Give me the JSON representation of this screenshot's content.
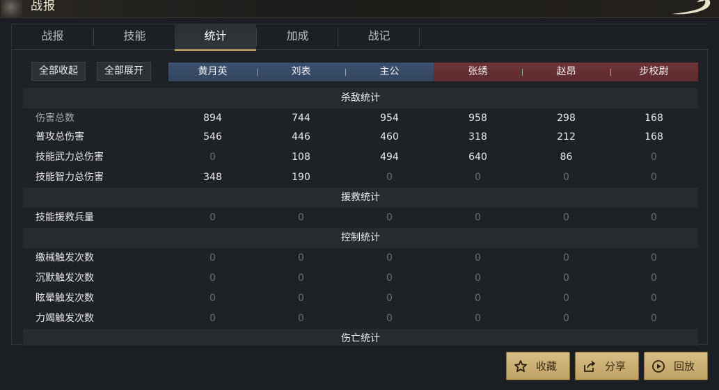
{
  "window": {
    "title": "战报"
  },
  "tabs": [
    {
      "label": "战报",
      "active": false
    },
    {
      "label": "技能",
      "active": false
    },
    {
      "label": "统计",
      "active": true
    },
    {
      "label": "加成",
      "active": false
    },
    {
      "label": "战记",
      "active": false
    }
  ],
  "controls": {
    "collapse_all": "全部收起",
    "expand_all": "全部展开"
  },
  "teams": {
    "blue": [
      "黄月英",
      "刘表",
      "主公"
    ],
    "red": [
      "张绣",
      "赵昂",
      "步校尉"
    ]
  },
  "sections": {
    "kill": "杀敌统计",
    "rescue": "援救统计",
    "control": "控制统计",
    "casualty": "伤亡统计"
  },
  "rows": {
    "total_damage": {
      "label": "伤害总数",
      "values": [
        "894",
        "744",
        "954",
        "958",
        "298",
        "168"
      ]
    },
    "normal_damage": {
      "label": "普攻总伤害",
      "values": [
        "546",
        "446",
        "460",
        "318",
        "212",
        "168"
      ]
    },
    "skill_force_damage": {
      "label": "技能武力总伤害",
      "values": [
        "0",
        "108",
        "494",
        "640",
        "86",
        "0"
      ]
    },
    "skill_int_damage": {
      "label": "技能智力总伤害",
      "values": [
        "348",
        "190",
        "0",
        "0",
        "0",
        "0"
      ]
    },
    "skill_rescue": {
      "label": "技能援救兵量",
      "values": [
        "0",
        "0",
        "0",
        "0",
        "0",
        "0"
      ]
    },
    "disarm": {
      "label": "缴械触发次数",
      "values": [
        "0",
        "0",
        "0",
        "0",
        "0",
        "0"
      ]
    },
    "silence": {
      "label": "沉默触发次数",
      "values": [
        "0",
        "0",
        "0",
        "0",
        "0",
        "0"
      ]
    },
    "stun": {
      "label": "眩晕触发次数",
      "values": [
        "0",
        "0",
        "0",
        "0",
        "0",
        "0"
      ]
    },
    "exhaust": {
      "label": "力竭触发次数",
      "values": [
        "0",
        "0",
        "0",
        "0",
        "0",
        "0"
      ]
    }
  },
  "buttons": {
    "favorite": "收藏",
    "share": "分享",
    "replay": "回放"
  },
  "colors": {
    "accent_gold": "#d6b55c",
    "team_blue": "#3c5170",
    "team_red": "#6f3438"
  }
}
